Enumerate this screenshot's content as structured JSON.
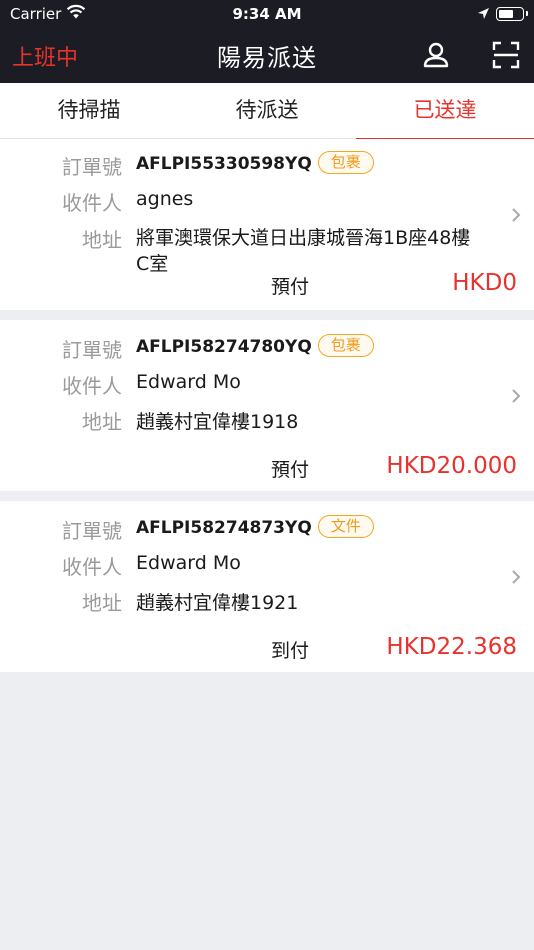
{
  "status_bar": {
    "carrier": "Carrier",
    "time": "9:34 AM"
  },
  "nav": {
    "status": "上班中",
    "title": "陽易派送",
    "icons": [
      "profile-icon",
      "scan-icon"
    ]
  },
  "tabs": [
    {
      "label": "待掃描",
      "active": false
    },
    {
      "label": "待派送",
      "active": false
    },
    {
      "label": "已送達",
      "active": true
    }
  ],
  "labels": {
    "order_no": "訂單號",
    "recipient": "收件人",
    "address": "地址"
  },
  "orders": [
    {
      "order_no": "AFLPI55330598YQ",
      "type": "包裹",
      "recipient": "agnes",
      "address_line1": "將軍澳環保大道日出康城晉海1B座48樓",
      "address_line2": "C室",
      "payment": "預付",
      "amount": "HKD0"
    },
    {
      "order_no": "AFLPI58274780YQ",
      "type": "包裹",
      "recipient": "Edward Mo",
      "address_line1": "趙義村宜偉樓1918",
      "payment": "預付",
      "amount": "HKD20.000"
    },
    {
      "order_no": "AFLPI58274873YQ",
      "type": "文件",
      "recipient": "Edward Mo",
      "address_line1": "趙義村宜偉樓1921",
      "payment": "到付",
      "amount": "HKD22.368"
    }
  ],
  "colors": {
    "accent": "#e8322d",
    "badge": "#f09b1d",
    "bar": "#1c1d24"
  }
}
